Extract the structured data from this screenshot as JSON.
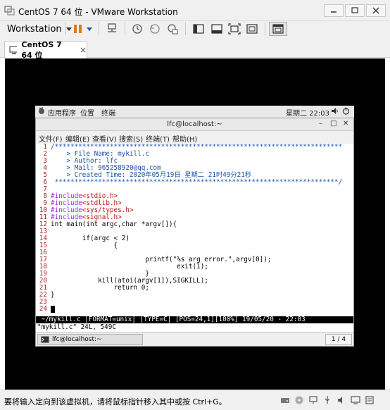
{
  "window": {
    "title": "CentOS 7 64 位 - VMware Workstation"
  },
  "toolbar": {
    "workstation_label": "Workstation"
  },
  "tab": {
    "label": "CentOS 7 64 位",
    "close": "×"
  },
  "gnome": {
    "applications": "应用程序",
    "places": "位置",
    "terminal": "终端",
    "clock": "星期二 22:03"
  },
  "terminal": {
    "title": "lfc@localhost:~",
    "menu": [
      "文件(F)",
      "编辑(E)",
      "查看(V)",
      "搜索(S)",
      "终端(T)",
      "帮助(H)"
    ]
  },
  "code": {
    "lines": [
      {
        "n": "1",
        "text": "/*************************************************************************"
      },
      {
        "n": "2",
        "text": "    > File Name: mykill.c"
      },
      {
        "n": "3",
        "text": "    > Author: lfc"
      },
      {
        "n": "4",
        "text": "    > Mail: 965258920@qq.com"
      },
      {
        "n": "5",
        "text": "    > Created Time: 2020年05月19日 星期二 21时49分21秒"
      },
      {
        "n": "6",
        "text": " ************************************************************************/"
      },
      {
        "n": "7",
        "text": ""
      },
      {
        "n": "8",
        "pre": "#include",
        "inc": "<stdio.h>"
      },
      {
        "n": "9",
        "pre": "#include",
        "inc": "<stdlib.h>"
      },
      {
        "n": "10",
        "pre": "#include",
        "inc": "<sys/types.h>"
      },
      {
        "n": "11",
        "pre": "#include",
        "inc": "<signal.h>"
      },
      {
        "n": "12",
        "text": "int main(int argc,char *argv[]){"
      },
      {
        "n": "13",
        "text": ""
      },
      {
        "n": "14",
        "text": "        if(argc < 2)"
      },
      {
        "n": "15",
        "text": "                {"
      },
      {
        "n": "16",
        "text": ""
      },
      {
        "n": "17",
        "text": "                        printf(\"%s arg error.\",argv[0]);"
      },
      {
        "n": "18",
        "text": "                                exit(1);"
      },
      {
        "n": "19",
        "text": "                        }"
      },
      {
        "n": "20",
        "text": "            kill(atoi(argv[1]),SIGKILL);"
      },
      {
        "n": "21",
        "text": "                return 0;"
      },
      {
        "n": "22",
        "text": "}"
      },
      {
        "n": "23",
        "text": ""
      },
      {
        "n": "24",
        "text": ""
      }
    ],
    "status_line": " ~/mykill.c |FORMAT=unix| |TYPE=C| [POS=24,1][100%] 19/05/20 - 22:03",
    "cmd_line": "\"mykill.c\" 24L, 549C"
  },
  "taskbar": {
    "item_label": "lfc@localhost:~",
    "pager": "1 / 4"
  },
  "statusbar": {
    "message": "要将输入定向到该虚拟机，请将鼠标指针移入其中或按 Ctrl+G。"
  },
  "colors": {
    "vm_background": "#000000",
    "comment": "#1a50a8",
    "preprocessor": "#a020f0",
    "string": "#c01010",
    "line_number": "#a52a2a"
  }
}
